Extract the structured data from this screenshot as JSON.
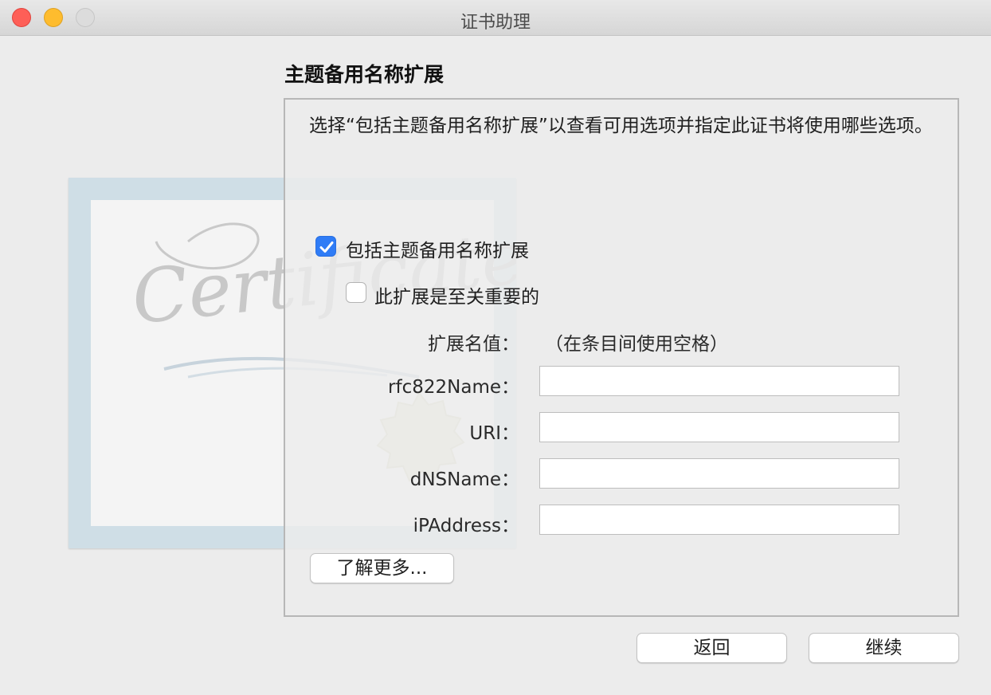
{
  "window": {
    "title": "证书助理"
  },
  "illustration": {
    "certificate_script": "Certificate"
  },
  "heading": "主题备用名称扩展",
  "description": "选择“包括主题备用名称扩展”以查看可用选项并指定此证书将使用哪些选项。",
  "options": {
    "include": {
      "label": "包括主题备用名称扩展",
      "checked": true
    },
    "critical": {
      "label": "此扩展是至关重要的",
      "checked": false
    }
  },
  "name_value": {
    "label": "扩展名值：",
    "hint": "（在条目间使用空格）"
  },
  "fields": {
    "rfc822": {
      "label": "rfc822Name：",
      "value": ""
    },
    "uri": {
      "label": "URI：",
      "value": ""
    },
    "dns": {
      "label": "dNSName：",
      "value": ""
    },
    "ip": {
      "label": "iPAddress：",
      "value": ""
    }
  },
  "buttons": {
    "learn_more": "了解更多...",
    "back": "返回",
    "continue": "继续"
  },
  "colors": {
    "accent": "#2f7cf6",
    "close": "#fe5f57",
    "minimize": "#febc2e"
  }
}
